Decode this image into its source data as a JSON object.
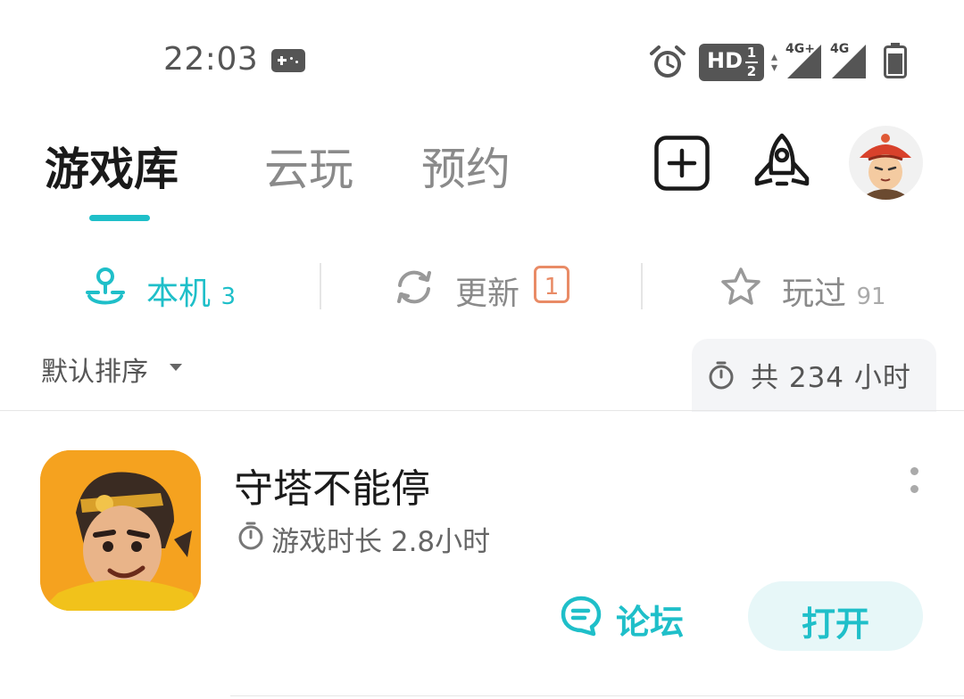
{
  "status_bar": {
    "time": "22:03",
    "hd_label": "HD",
    "hd_fraction_top": "1",
    "hd_fraction_bottom": "2",
    "network_1": "4G+",
    "network_2": "4G",
    "icons": [
      "gamepad-icon",
      "alarm-icon",
      "hd-voice-icon",
      "data-arrows-icon",
      "signal-icon",
      "signal-icon",
      "battery-icon"
    ]
  },
  "header": {
    "tabs": [
      {
        "label": "游戏库",
        "active": true
      },
      {
        "label": "云玩",
        "active": false
      },
      {
        "label": "预约",
        "active": false
      }
    ],
    "actions": [
      "add-icon",
      "rocket-icon",
      "avatar"
    ]
  },
  "sub_tabs": [
    {
      "label": "本机",
      "count": "3",
      "icon": "joystick-icon",
      "active": true
    },
    {
      "label": "更新",
      "badge": "1",
      "icon": "refresh-icon",
      "active": false
    },
    {
      "label": "玩过",
      "count": "91",
      "icon": "star-icon",
      "active": false
    }
  ],
  "sort": {
    "label": "默认排序",
    "total_text": "共 234 小时"
  },
  "games": [
    {
      "title": "守塔不能停",
      "play_time": "游戏时长 2.8小时",
      "forum_label": "论坛",
      "open_label": "打开"
    }
  ],
  "colors": {
    "accent": "#1fbfc9",
    "badge": "#e98b66",
    "muted": "#8a8a8a"
  }
}
